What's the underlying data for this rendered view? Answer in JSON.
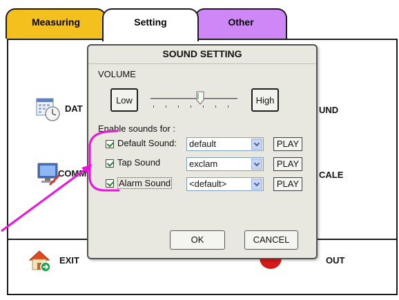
{
  "tabs": [
    {
      "label": "Measuring",
      "color": "#f4c01d"
    },
    {
      "label": "Setting",
      "color": "#ffffff"
    },
    {
      "label": "Other",
      "color": "#cf86f7"
    }
  ],
  "background": {
    "date_label": "DAT",
    "comm_label": "COMM",
    "sound_label": "UND",
    "scale_label": "CALE",
    "exit_label": "EXIT",
    "logout_label": "OUT"
  },
  "dialog": {
    "title": "SOUND SETTING",
    "volume_label": "VOLUME",
    "low_label": "Low",
    "high_label": "High",
    "volume_level": 0.58,
    "enable_label": "Enable sounds for :",
    "sounds": [
      {
        "label": "Default Sound:",
        "value": "default",
        "checked": true,
        "play_label": "PLAY"
      },
      {
        "label": "Tap Sound",
        "value": "exclam",
        "checked": true,
        "play_label": "PLAY"
      },
      {
        "label": "Alarm Sound",
        "value": "<default>",
        "checked": true,
        "play_label": "PLAY"
      }
    ],
    "ok_label": "OK",
    "cancel_label": "CANCEL"
  },
  "annotation_color": "#ee11dd"
}
